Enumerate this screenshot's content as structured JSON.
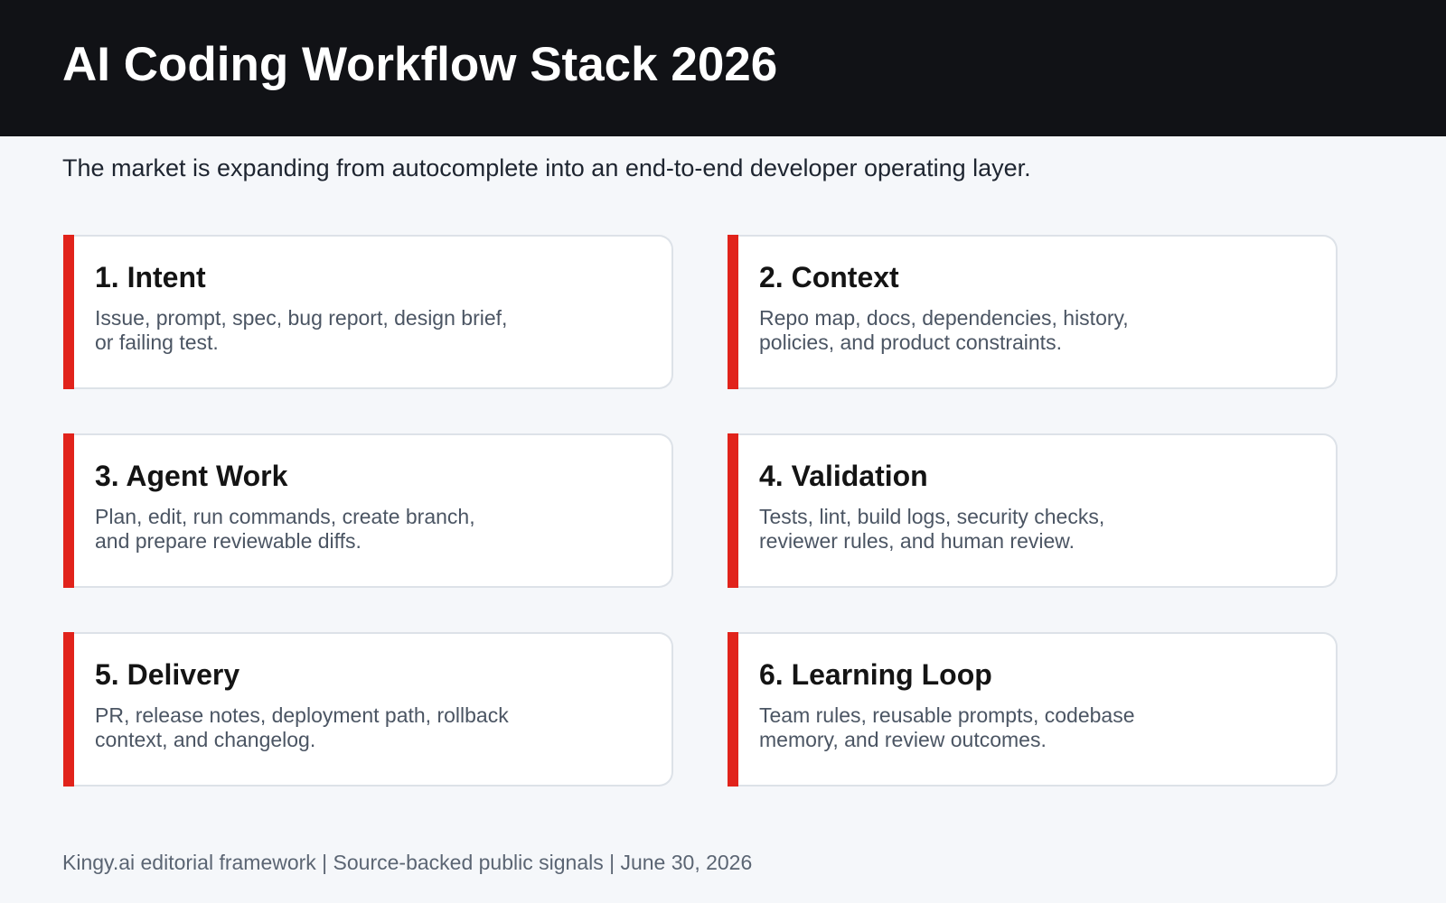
{
  "header": {
    "title": "AI Coding Workflow Stack 2026"
  },
  "subtitle": "The market is expanding from autocomplete into an end-to-end developer operating layer.",
  "accent_color": "#e1231b",
  "header_background": "#111216",
  "cards": [
    {
      "title": "1. Intent",
      "description": "Issue, prompt, spec, bug report, design brief, or failing test."
    },
    {
      "title": "2. Context",
      "description": "Repo map, docs, dependencies, history, policies, and product constraints."
    },
    {
      "title": "3. Agent Work",
      "description": "Plan, edit, run commands, create branch, and prepare reviewable diffs."
    },
    {
      "title": "4. Validation",
      "description": "Tests, lint, build logs, security checks, reviewer rules, and human review."
    },
    {
      "title": "5. Delivery",
      "description": "PR, release notes, deployment path, rollback context, and changelog."
    },
    {
      "title": "6. Learning Loop",
      "description": "Team rules, reusable prompts, codebase memory, and review outcomes."
    }
  ],
  "footer": "Kingy.ai editorial framework | Source-backed public signals | June 30, 2026"
}
